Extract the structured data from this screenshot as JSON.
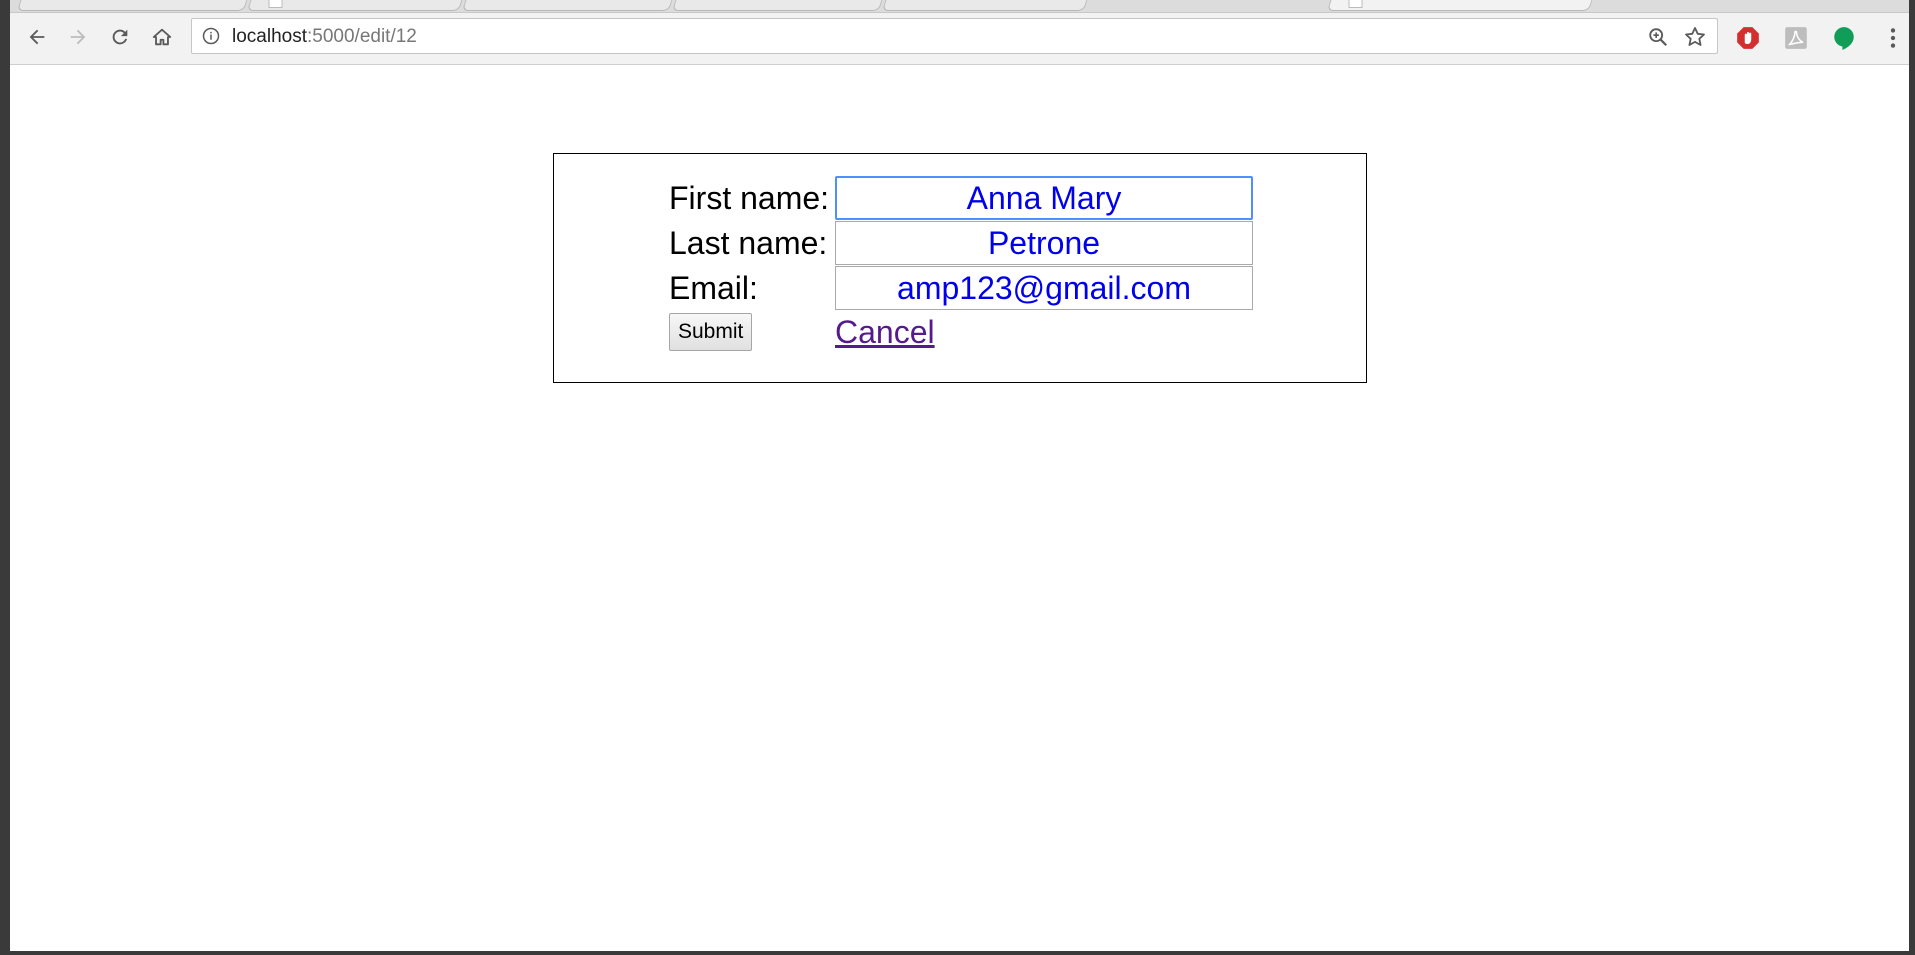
{
  "browser": {
    "url_host": "localhost",
    "url_path": ":5000/edit/12",
    "icons": {
      "back": "back-arrow-icon",
      "forward": "forward-arrow-icon",
      "reload": "reload-icon",
      "home": "home-icon",
      "info": "info-icon",
      "zoom": "zoom-icon",
      "bookmark": "star-icon",
      "ext_stop": "stop-extension-icon",
      "ext_pdf": "pdf-extension-icon",
      "ext_chat": "chat-extension-icon",
      "menu": "more-menu-icon"
    },
    "colors": {
      "focus_ring": "#4d90fe",
      "ext_stop": "#d32f2f",
      "ext_chat": "#0f9d58"
    }
  },
  "form": {
    "first_name_label": "First name:",
    "first_name_value": "Anna Mary",
    "last_name_label": "Last name:",
    "last_name_value": "Petrone",
    "email_label": "Email:",
    "email_value": "amp123@gmail.com",
    "submit_label": "Submit",
    "cancel_label": "Cancel",
    "colors": {
      "input_text": "#0000ee",
      "visited_link": "#551a8b"
    }
  }
}
